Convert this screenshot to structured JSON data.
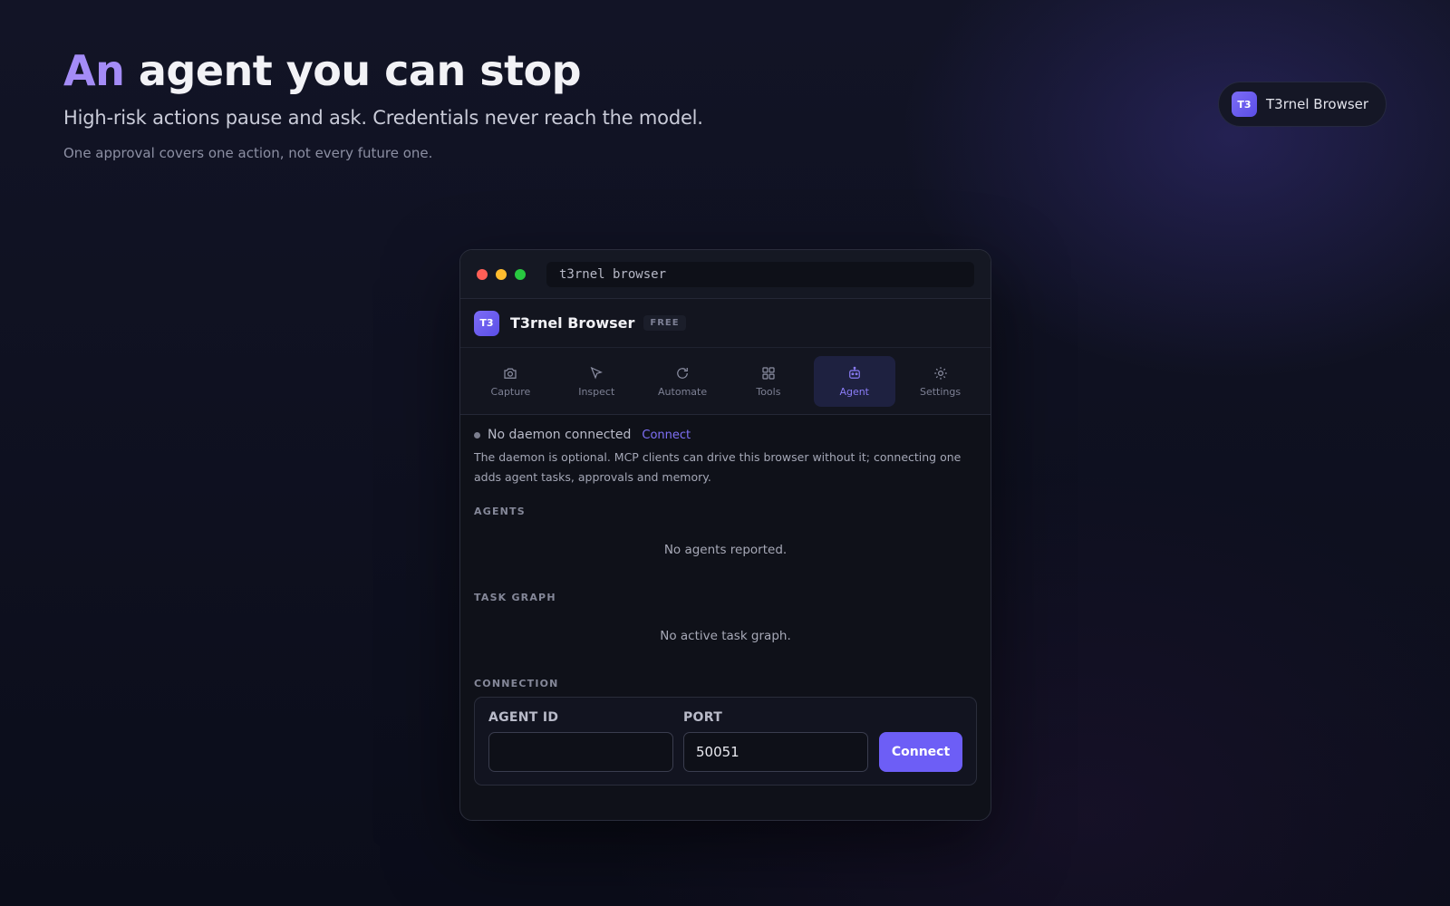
{
  "hero": {
    "title_accent": "An",
    "title_rest": " agent you can stop",
    "subtitle": "High-risk actions pause and ask. Credentials never reach the model.",
    "note": "One approval covers one action, not every future one."
  },
  "brand_pill": {
    "logo": "T3",
    "label": "T3rnel Browser"
  },
  "window": {
    "address": "t3rnel browser",
    "app": {
      "logo": "T3",
      "name": "T3rnel Browser",
      "tag": "FREE"
    },
    "tabs": [
      {
        "label": "Capture",
        "icon": "camera-icon"
      },
      {
        "label": "Inspect",
        "icon": "cursor-icon"
      },
      {
        "label": "Automate",
        "icon": "refresh-icon"
      },
      {
        "label": "Tools",
        "icon": "grid-icon"
      },
      {
        "label": "Agent",
        "icon": "robot-icon",
        "active": true
      },
      {
        "label": "Settings",
        "icon": "gear-icon"
      }
    ],
    "status": {
      "text": "No daemon connected",
      "link": "Connect",
      "description": "The daemon is optional. MCP clients can drive this browser without it; connecting one adds agent tasks, approvals and memory."
    },
    "sections": {
      "agents_label": "AGENTS",
      "agents_empty": "No agents reported.",
      "task_graph_label": "TASK GRAPH",
      "task_graph_empty": "No active task graph.",
      "connection_label": "CONNECTION"
    },
    "connection": {
      "agent_id_label": "AGENT ID",
      "agent_id_value": "",
      "port_label": "PORT",
      "port_value": "50051",
      "connect_label": "Connect"
    }
  },
  "colors": {
    "accent": "#6d5ef6",
    "accent_text": "#a48cf7",
    "background": "#0c0e1b"
  }
}
